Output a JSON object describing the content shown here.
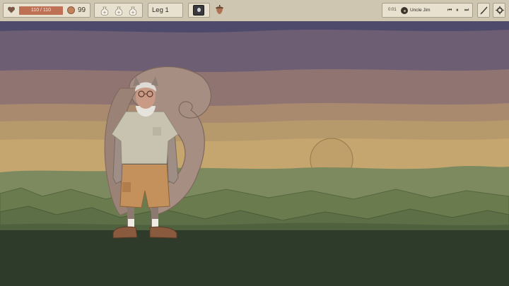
{
  "hud": {
    "health": {
      "text": "110 / 110",
      "current": 110,
      "max": 110,
      "fraction": 1.0
    },
    "coins": "99",
    "bags": [
      {
        "icon": "money-bag-icon"
      },
      {
        "icon": "money-bag-icon"
      },
      {
        "icon": "money-bag-icon"
      }
    ],
    "leg": "Leg 1",
    "item_icon": "dark-item-icon",
    "acorn_icon": "acorn-icon",
    "music": {
      "time": "0:01",
      "track": "Uncle Jim",
      "controls": {
        "prev": "⏮",
        "pause": "⏸",
        "next": "⏭"
      }
    },
    "brush_icon": "brush-icon",
    "settings_icon": "settings-icon"
  },
  "scene": {
    "character": "Uncle Jim",
    "colors": {
      "sky_top": "#4d4a6b",
      "band_purple": "#6d5e73",
      "band_mauve": "#8f7472",
      "band_tan": "#aa8a6f",
      "band_ochre": "#b69a6b",
      "band_yellow": "#c4a66e",
      "sun": "#bfa06a",
      "hills_back": "#7d8a5f",
      "hills_mid": "#6a7c4e",
      "hills_front": "#5c6f46",
      "ground": "#2f3b2a"
    }
  }
}
